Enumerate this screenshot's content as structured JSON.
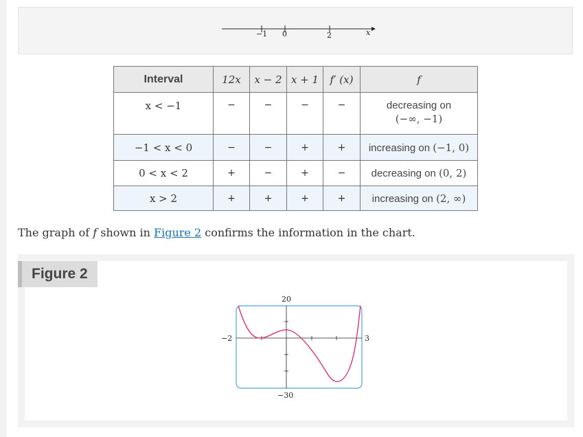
{
  "number_line": {
    "tick_labels": [
      "−1",
      "0",
      "2"
    ],
    "axis_label": "x"
  },
  "sign_chart": {
    "headers": {
      "interval": "Interval",
      "factor1": "12x",
      "factor2": "x − 2",
      "factor3": "x + 1",
      "derivative": "f′ (x)",
      "function": "f"
    },
    "rows": [
      {
        "interval": "x < −1",
        "s1": "−",
        "s2": "−",
        "s3": "−",
        "s4": "−",
        "f_text": "decreasing on",
        "f_range": "(−∞, −1)"
      },
      {
        "interval": "−1 < x < 0",
        "s1": "−",
        "s2": "−",
        "s3": "+",
        "s4": "+",
        "f_text": "increasing on",
        "f_range": "(−1, 0)"
      },
      {
        "interval": "0 < x < 2",
        "s1": "+",
        "s2": "−",
        "s3": "+",
        "s4": "−",
        "f_text": "decreasing on",
        "f_range": "(0, 2)"
      },
      {
        "interval": "x > 2",
        "s1": "+",
        "s2": "+",
        "s3": "+",
        "s4": "+",
        "f_text": "increasing on",
        "f_range": "(2, ∞)"
      }
    ]
  },
  "paragraph": {
    "before": "The graph of ",
    "f": "f",
    "middle": " shown in ",
    "link": "Figure 2",
    "after": " confirms the information in the chart."
  },
  "figure": {
    "label": "Figure 2",
    "y_top_label": "20",
    "y_bottom_label": "−30",
    "x_left_label": "−2",
    "x_right_label": "3"
  },
  "colors": {
    "curve": "#d6246e",
    "window_border": "#4fa3d8"
  }
}
